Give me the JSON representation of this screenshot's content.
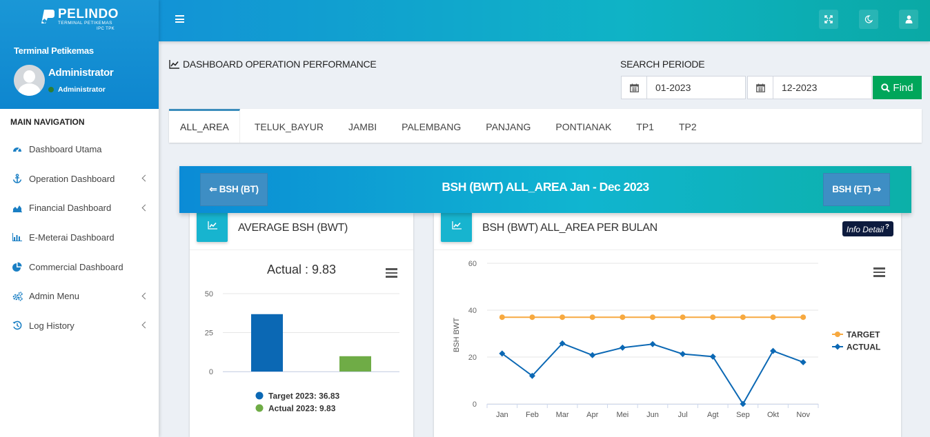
{
  "brand": {
    "logo_text": "PELINDO",
    "logo_sub": "TERMINAL PETIKEMAS",
    "logo_sub2": "IPC TPK",
    "org_name": "Terminal Petikemas"
  },
  "user": {
    "name": "Administrator",
    "role": "Administrator",
    "status_color": "#2e7d32"
  },
  "nav": {
    "header": "MAIN NAVIGATION",
    "items": [
      {
        "label": "Dashboard Utama",
        "icon": "dashboard-icon"
      },
      {
        "label": "Operation Dashboard",
        "icon": "anchor-icon"
      },
      {
        "label": "Financial Dashboard",
        "icon": "area-chart-icon"
      },
      {
        "label": "E-Meterai Dashboard",
        "icon": "bar-chart-icon"
      },
      {
        "label": "Commercial Dashboard",
        "icon": "pie-chart-icon"
      },
      {
        "label": "Admin Menu",
        "icon": "cogs-icon"
      },
      {
        "label": "Log History",
        "icon": "history-icon"
      }
    ]
  },
  "page": {
    "title": "DASHBOARD OPERATION PERFORMANCE"
  },
  "search": {
    "label": "SEARCH PERIODE",
    "from": "01-2023",
    "to": "12-2023",
    "find_label": "Find"
  },
  "tabs": [
    "ALL_AREA",
    "TELUK_BAYUR",
    "JAMBI",
    "PALEMBANG",
    "PANJANG",
    "PONTIANAK",
    "TP1",
    "TP2"
  ],
  "banner": {
    "title": "BSH (BWT) ALL_AREA Jan - Dec 2023",
    "prev_label": "⇐ BSH (BT)",
    "next_label": "BSH (ET) ⇒"
  },
  "avg_card": {
    "title": "AVERAGE BSH (BWT)"
  },
  "monthly_card": {
    "title": "BSH (BWT) ALL_AREA PER BULAN",
    "info_label": "Info Detail"
  },
  "colors": {
    "target": "#f7a940",
    "actual": "#0b68b4",
    "actual_bar": "#6fac46",
    "accent": "#00a65a"
  },
  "chart_data": [
    {
      "type": "bar",
      "title": "Actual : 9.83",
      "categories": [
        "Target 2023",
        "Actual 2023"
      ],
      "values": [
        36.83,
        9.83
      ],
      "legend": [
        "Target 2023: 36.83",
        "Actual 2023: 9.83"
      ],
      "ylim": [
        0,
        50
      ],
      "yticks": [
        0,
        25,
        50
      ],
      "grid": true,
      "legend_position": "bottom"
    },
    {
      "type": "line",
      "categories": [
        "Jan",
        "Feb",
        "Mar",
        "Apr",
        "Mei",
        "Jun",
        "Jul",
        "Agt",
        "Sep",
        "Okt",
        "Nov"
      ],
      "ylabel": "BSH BWT",
      "ylim": [
        0,
        60
      ],
      "yticks": [
        0,
        20,
        40,
        60
      ],
      "grid": true,
      "legend_position": "right",
      "series": [
        {
          "name": "TARGET",
          "values": [
            37,
            37,
            37,
            37,
            37,
            37,
            37,
            37,
            37,
            37,
            37
          ]
        },
        {
          "name": "ACTUAL",
          "values": [
            21.5,
            12,
            25.8,
            20.8,
            24,
            25.5,
            21.3,
            20.2,
            0,
            22.6,
            17.8
          ]
        }
      ]
    }
  ]
}
